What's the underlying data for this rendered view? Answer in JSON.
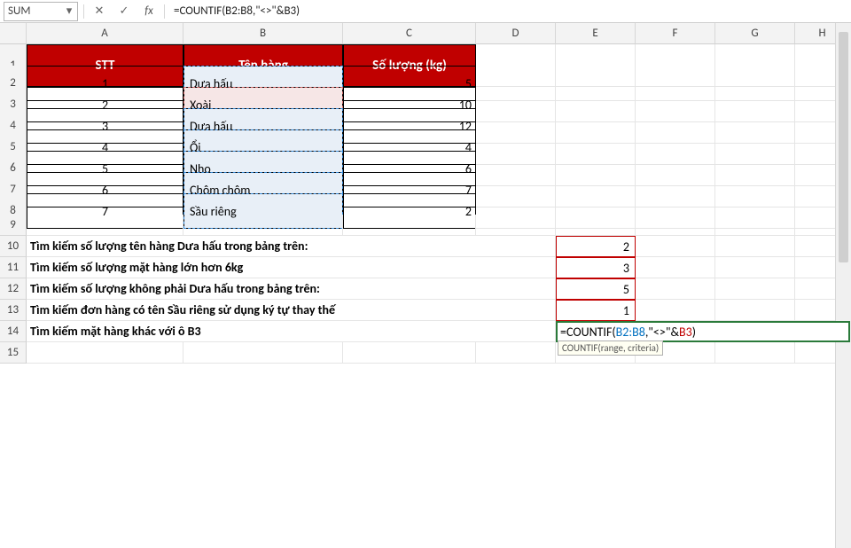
{
  "name_box": "SUM",
  "formula_bar": "=COUNTIF(B2:B8,\"<>\"&B3)",
  "icons": {
    "cancel": "✕",
    "enter": "✓",
    "fx": "fx",
    "dropdown": "▾"
  },
  "col_headers": [
    "A",
    "B",
    "C",
    "D",
    "E",
    "F",
    "G",
    "H"
  ],
  "row_headers": [
    "1",
    "2",
    "3",
    "4",
    "5",
    "6",
    "7",
    "8",
    "9",
    "10",
    "11",
    "12",
    "13",
    "14",
    "15"
  ],
  "table": {
    "headers": {
      "a": "STT",
      "b": "Tên hàng",
      "c": "Số lượng (kg)"
    },
    "rows": [
      {
        "stt": "1",
        "name": "Dưa hấu",
        "qty": "5"
      },
      {
        "stt": "2",
        "name": "Xoài",
        "qty": "10"
      },
      {
        "stt": "3",
        "name": "Dưa hấu",
        "qty": "12"
      },
      {
        "stt": "4",
        "name": "Ổi",
        "qty": "4"
      },
      {
        "stt": "5",
        "name": "Nho",
        "qty": "6"
      },
      {
        "stt": "6",
        "name": "Chôm chôm",
        "qty": "7"
      },
      {
        "stt": "7",
        "name": "Sầu riêng",
        "qty": "2"
      }
    ]
  },
  "queries": [
    "Tìm kiếm số lượng tên hàng Dưa hấu trong bảng trên:",
    "Tìm kiếm số lượng mặt hàng lớn hơn 6kg",
    "Tìm kiếm số lượng không phải Dưa hấu trong bảng trên:",
    "Tìm kiếm đơn hàng có tên Sầu riêng sử dụng ký tự thay thế",
    "Tìm kiếm mặt hàng khác với ô B3"
  ],
  "results": [
    "2",
    "3",
    "5",
    "1"
  ],
  "editing_formula": {
    "p1": "=COUNTIF(",
    "p2": "B2:B8",
    "p3": ",\"<>\"&",
    "p4": "B3",
    "p5": ")"
  },
  "tooltip": "COUNTIF(range, criteria)"
}
